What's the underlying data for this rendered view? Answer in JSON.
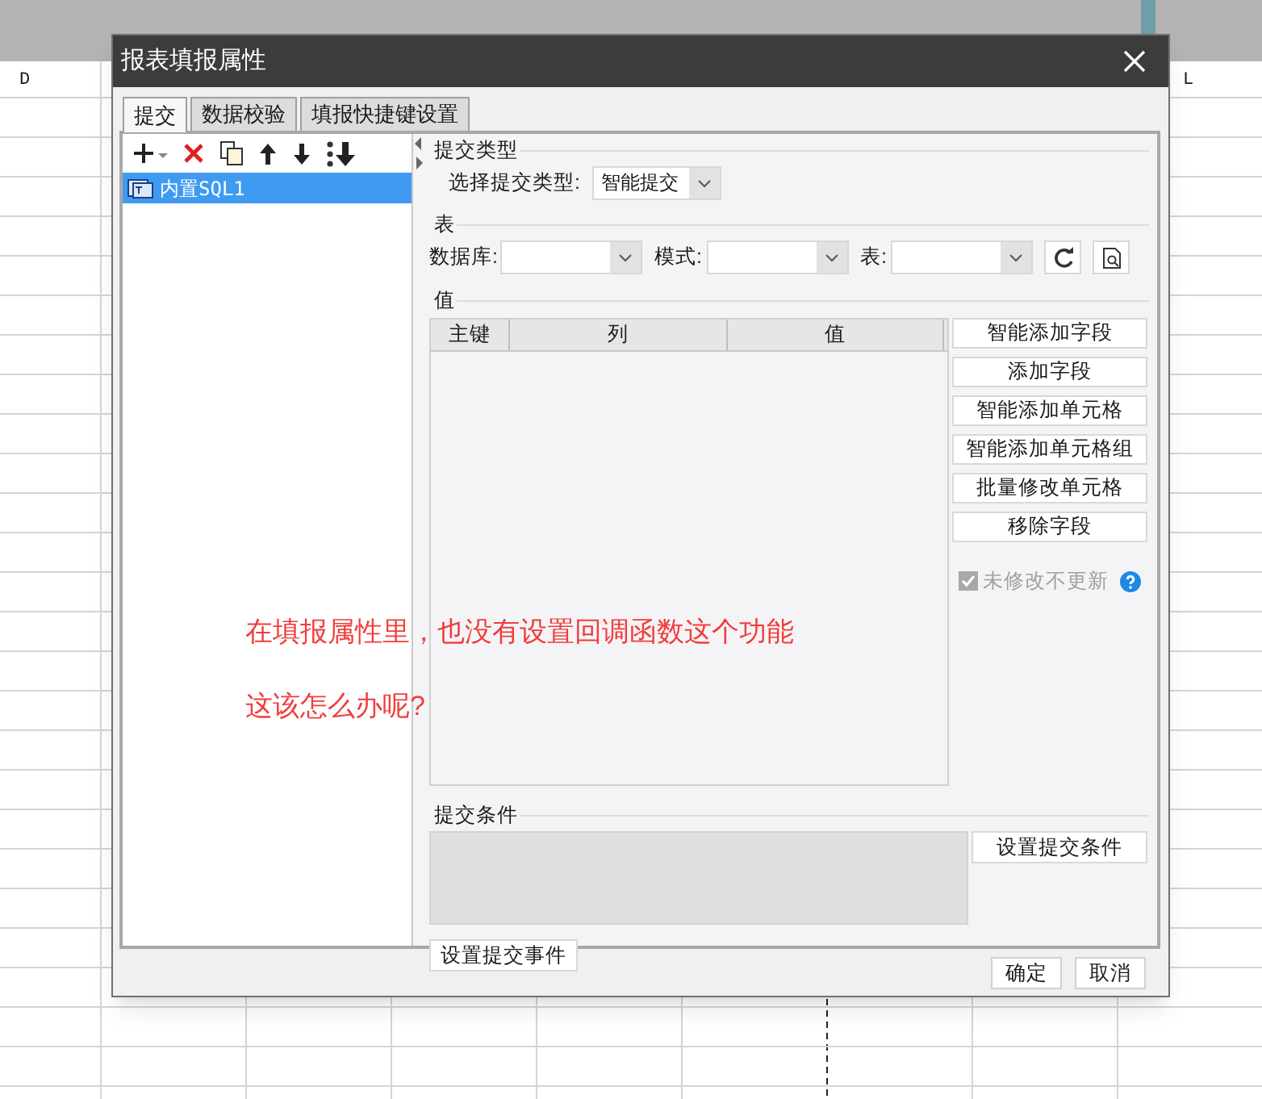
{
  "sheet": {
    "column_headers": [
      {
        "label": "D"
      },
      {
        "label": "L"
      }
    ]
  },
  "dialog": {
    "title": "报表填报属性",
    "tabs": [
      {
        "label": "提交",
        "selected": true
      },
      {
        "label": "数据校验",
        "selected": false
      },
      {
        "label": "填报快捷键设置",
        "selected": false
      }
    ],
    "tree_items": [
      {
        "label": "内置SQL1",
        "selected": true
      }
    ],
    "submit_type": {
      "heading": "提交类型",
      "label": "选择提交类型:",
      "value": "智能提交"
    },
    "table_section": {
      "heading": "表",
      "fields": [
        {
          "label": "数据库:"
        },
        {
          "label": "模式:"
        },
        {
          "label": "表:"
        }
      ]
    },
    "values_section": {
      "heading": "值",
      "columns": [
        "主键",
        "列",
        "值"
      ],
      "buttons": [
        "智能添加字段",
        "添加字段",
        "智能添加单元格",
        "智能添加单元格组",
        "批量修改单元格",
        "移除字段"
      ],
      "checkbox": {
        "label": "未修改不更新",
        "checked": true,
        "disabled": true
      }
    },
    "condition_section": {
      "heading": "提交条件",
      "button": "设置提交条件"
    },
    "event_button": "设置提交事件",
    "footer_buttons": [
      "确定",
      "取消"
    ]
  },
  "annotation": {
    "lines": [
      "在填报属性里，也没有设置回调函数这个功能",
      "这该怎么办呢?"
    ]
  }
}
